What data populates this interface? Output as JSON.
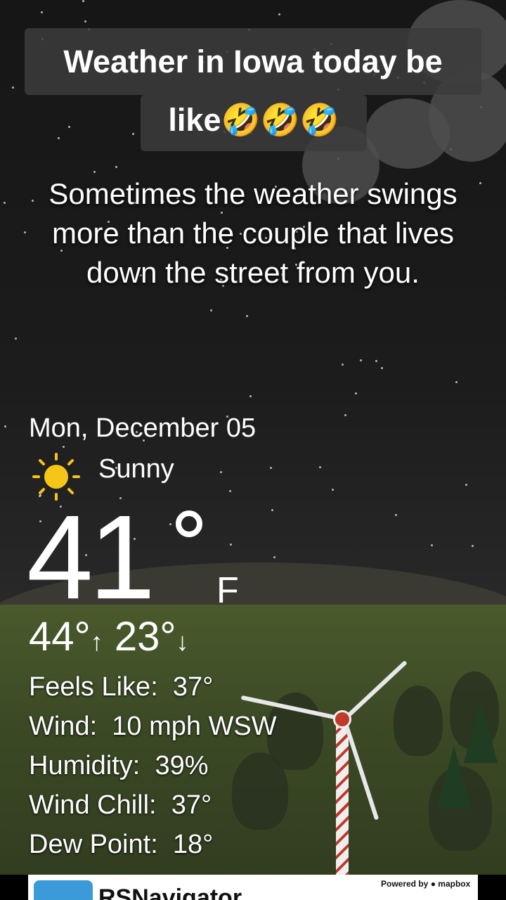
{
  "title": {
    "line1": "Weather in Iowa today be",
    "line2": "like🤣🤣🤣"
  },
  "caption": "Sometimes the weather swings more than the couple that lives down the street from you.",
  "weather": {
    "date": "Mon, December 05",
    "condition": "Sunny",
    "condition_icon": "sun-icon",
    "temperature": "41",
    "unit": "F",
    "high": "44°",
    "low": "23°",
    "details": [
      {
        "label": "Feels Like:",
        "value": "37°"
      },
      {
        "label": "Wind:",
        "value": "10 mph WSW"
      },
      {
        "label": "Humidity:",
        "value": "39%"
      },
      {
        "label": "Wind Chill:",
        "value": "37°"
      },
      {
        "label": "Dew Point:",
        "value": "18°"
      }
    ]
  },
  "ad": {
    "title": "RSNavigator",
    "powered_by": "Powered by ● mapbox"
  },
  "colors": {
    "sun": "#f5c518",
    "turbine_stripe": "#c0392b",
    "ground": "#4a5a2c"
  }
}
